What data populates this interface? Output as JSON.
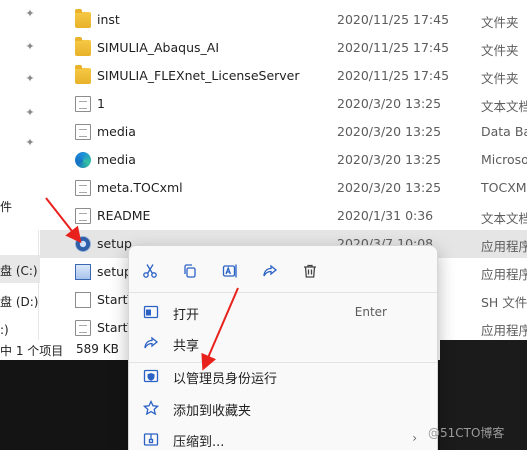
{
  "nav": {
    "labels": [
      "件",
      "盘 (C:)",
      "盘 (D:)",
      ":)"
    ]
  },
  "files": [
    {
      "name": "inst",
      "date": "2020/11/25 17:45",
      "type": "文件夹",
      "icon": "folder-icon"
    },
    {
      "name": "SIMULIA_Abaqus_AI",
      "date": "2020/11/25 17:45",
      "type": "文件夹",
      "icon": "folder-icon"
    },
    {
      "name": "SIMULIA_FLEXnet_LicenseServer",
      "date": "2020/11/25 17:45",
      "type": "文件夹",
      "icon": "folder-icon"
    },
    {
      "name": "1",
      "date": "2020/3/20 13:25",
      "type": "文本文档",
      "icon": "text-file-icon"
    },
    {
      "name": "media",
      "date": "2020/3/20 13:25",
      "type": "Data Ba",
      "icon": "data-file-icon"
    },
    {
      "name": "media",
      "date": "2020/3/20 13:25",
      "type": "Microso",
      "icon": "edge-icon"
    },
    {
      "name": "meta.TOCxml",
      "date": "2020/3/20 13:25",
      "type": "TOCXM",
      "icon": "xml-file-icon"
    },
    {
      "name": "README",
      "date": "2020/1/31 0:36",
      "type": "文本文档",
      "icon": "text-file-icon"
    },
    {
      "name": "setup",
      "date": "2020/3/7 10:08",
      "type": "应用程序",
      "icon": "setup-gear-icon",
      "selected": true
    },
    {
      "name": "setup",
      "date": "",
      "type": "应用程序",
      "icon": "setup-window-icon"
    },
    {
      "name": "StartT",
      "date": "",
      "type": "SH 文件",
      "icon": "sh-file-icon"
    },
    {
      "name": "StartT",
      "date": "",
      "type": "应用程序",
      "icon": "app-file-icon"
    }
  ],
  "status": {
    "count": "中 1 个项目",
    "size": "589 KB"
  },
  "context_menu": {
    "toolbar": [
      "cut-icon",
      "copy-icon",
      "rename-icon",
      "share-icon",
      "delete-icon"
    ],
    "items": [
      {
        "label": "打开",
        "shortcut": "Enter",
        "icon": "open-icon"
      },
      {
        "label": "共享",
        "shortcut": "",
        "icon": "share-icon"
      },
      {
        "label": "以管理员身份运行",
        "shortcut": "",
        "icon": "admin-shield-icon"
      },
      {
        "label": "添加到收藏夹",
        "shortcut": "",
        "icon": "star-icon"
      },
      {
        "label": "压缩到...",
        "shortcut": "",
        "icon": "zip-icon",
        "submenu_arrow": "›"
      }
    ]
  },
  "watermark": "@51CTO博客",
  "colors": {
    "selection": "#e5e5e5",
    "accent": "#2b62c5",
    "arrow": "#e8211c"
  }
}
